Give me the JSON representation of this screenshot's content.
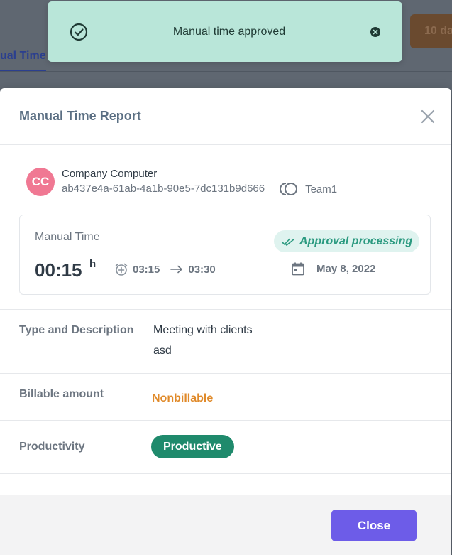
{
  "background": {
    "tab_label": "ual Time",
    "button_label": "10 da"
  },
  "toast": {
    "message": "Manual time approved",
    "icon": "check-circle-icon",
    "close_icon": "close-circle-icon",
    "color": "#b9e6d9"
  },
  "modal": {
    "title": "Manual Time Report",
    "device": {
      "avatar_initials": "CC",
      "avatar_color": "#f07893",
      "name": "Company Computer",
      "id": "ab437e4a-61ab-4a1b-90e5-7dc131b9d666",
      "team": "Team1"
    },
    "time_card": {
      "label": "Manual Time",
      "duration": "00:15",
      "duration_unit": "h",
      "start": "03:15",
      "end": "03:30",
      "status": "Approval processing",
      "date": "May 8, 2022"
    },
    "details": {
      "type_label": "Type and Description",
      "type_value": "Meeting with clients",
      "description": "asd",
      "billable_label": "Billable amount",
      "billable_value": "Nonbillable",
      "productivity_label": "Productivity",
      "productivity_value": "Productive"
    },
    "footer": {
      "close_label": "Close"
    }
  },
  "colors": {
    "accent": "#6d5ce8",
    "productive": "#1f8a6c",
    "nonbillable": "#e08a2a",
    "approval_text": "#2b9a80"
  }
}
